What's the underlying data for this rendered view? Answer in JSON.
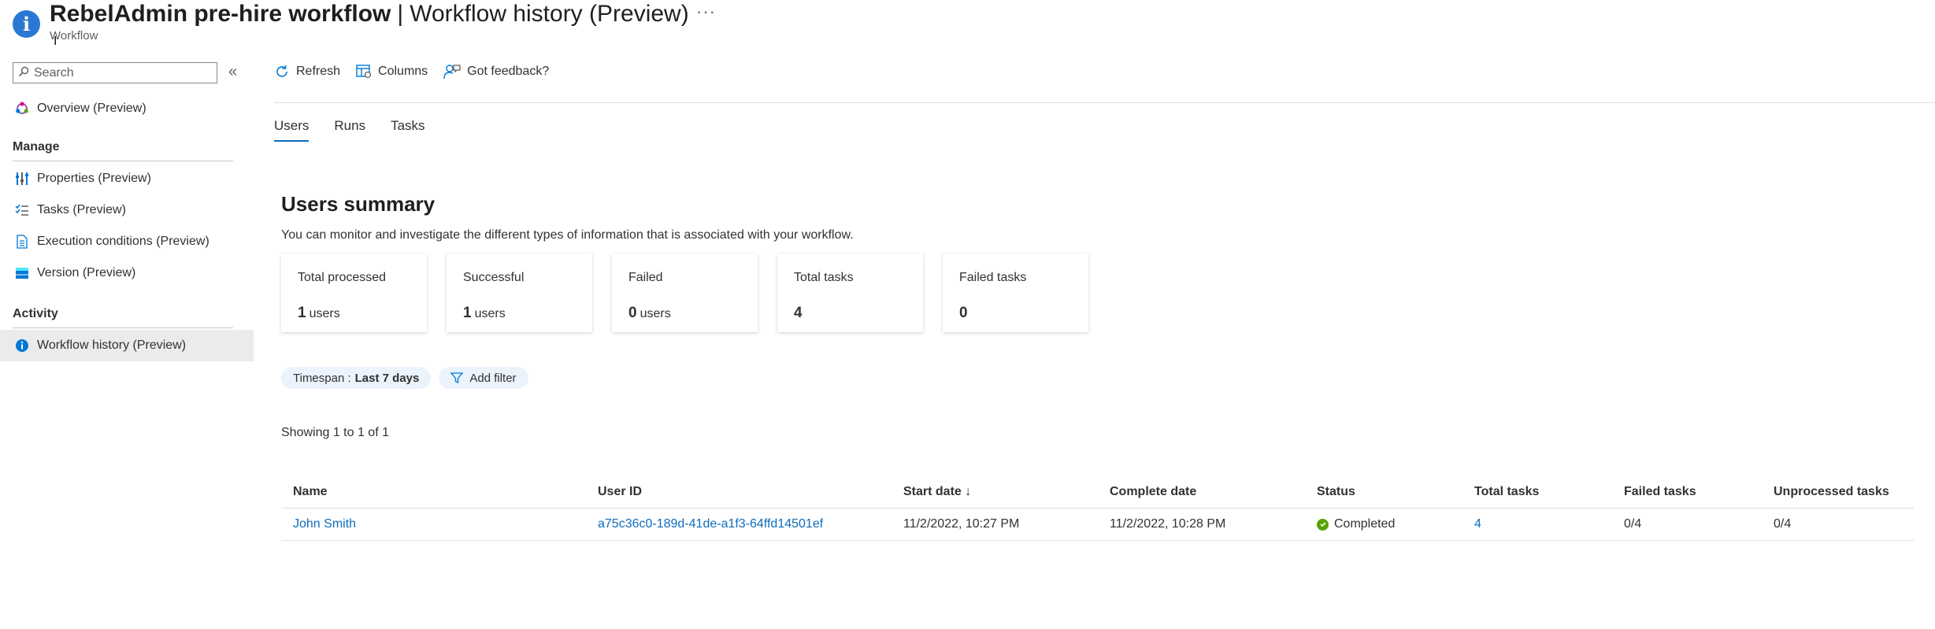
{
  "header": {
    "resource_name": "RebelAdmin pre-hire workflow",
    "separator": "|",
    "page_title": "Workflow history (Preview)",
    "subtitle": "Workflow",
    "more_label": "···",
    "icon": "info-icon"
  },
  "sidebar": {
    "search_placeholder": "Search",
    "collapse_label": "«",
    "overview": "Overview (Preview)",
    "sections": {
      "manage": "Manage",
      "activity": "Activity"
    },
    "manage_items": [
      {
        "label": "Properties (Preview)",
        "icon": "properties-icon"
      },
      {
        "label": "Tasks (Preview)",
        "icon": "tasks-icon"
      },
      {
        "label": "Execution conditions (Preview)",
        "icon": "document-icon"
      },
      {
        "label": "Version (Preview)",
        "icon": "version-icon"
      }
    ],
    "activity_items": [
      {
        "label": "Workflow history (Preview)",
        "icon": "info-icon",
        "active": true
      }
    ]
  },
  "toolbar": {
    "refresh": "Refresh",
    "columns": "Columns",
    "feedback": "Got feedback?"
  },
  "tabs": [
    {
      "label": "Users",
      "active": true
    },
    {
      "label": "Runs",
      "active": false
    },
    {
      "label": "Tasks",
      "active": false
    }
  ],
  "summary": {
    "title": "Users summary",
    "description": "You can monitor and investigate the different types of information that is associated with your workflow.",
    "cards": [
      {
        "label": "Total processed",
        "value": "1",
        "unit": "users"
      },
      {
        "label": "Successful",
        "value": "1",
        "unit": "users"
      },
      {
        "label": "Failed",
        "value": "0",
        "unit": "users"
      },
      {
        "label": "Total tasks",
        "value": "4",
        "unit": ""
      },
      {
        "label": "Failed tasks",
        "value": "0",
        "unit": ""
      }
    ]
  },
  "filters": {
    "timespan_label": "Timespan :",
    "timespan_value": "Last 7 days",
    "add_filter": "Add filter"
  },
  "showing": "Showing 1 to 1 of 1",
  "table": {
    "columns": [
      "Name",
      "User ID",
      "Start date ↓",
      "Complete date",
      "Status",
      "Total tasks",
      "Failed tasks",
      "Unprocessed tasks"
    ],
    "rows": [
      {
        "name": "John Smith",
        "user_id": "a75c36c0-189d-41de-a1f3-64ffd14501ef",
        "start_date": "11/2/2022, 10:27 PM",
        "complete_date": "11/2/2022, 10:28 PM",
        "status": "Completed",
        "total_tasks": "4",
        "failed_tasks": "0/4",
        "unprocessed_tasks": "0/4"
      }
    ]
  },
  "colors": {
    "accent": "#0f6cbd",
    "success": "#57a300",
    "header_icon": "#2b78d4"
  }
}
